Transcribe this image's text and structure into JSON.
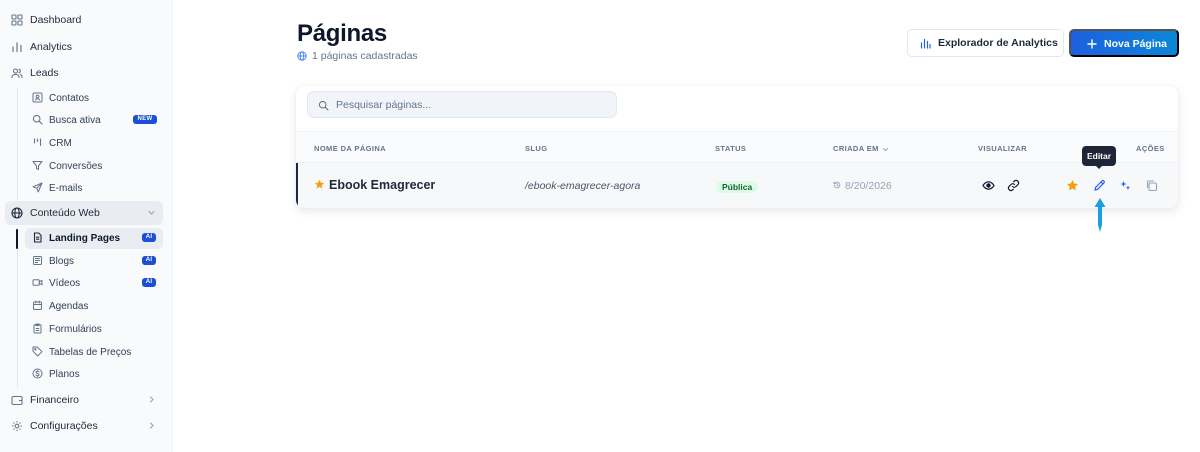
{
  "sidebar": {
    "dashboard": "Dashboard",
    "analytics": "Analytics",
    "leads": {
      "label": "Leads",
      "items": [
        "Contatos",
        "Busca ativa",
        "CRM",
        "Conversões",
        "E-mails"
      ],
      "new_badge": "NEW"
    },
    "content": {
      "label": "Conteúdo Web",
      "items": [
        "Landing Pages",
        "Blogs",
        "Vídeos",
        "Agendas",
        "Formulários",
        "Tabelas de Preços",
        "Planos"
      ],
      "ai_badge": "AI"
    },
    "financeiro": "Financeiro",
    "configuracoes": "Configurações"
  },
  "page": {
    "title": "Páginas",
    "subtitle": "1 páginas cadastradas"
  },
  "toolbar": {
    "analytics_label": "Explorador de Analytics",
    "new_label": "Nova Página"
  },
  "search": {
    "placeholder": "Pesquisar páginas..."
  },
  "table": {
    "headers": [
      "NOME DA PÁGINA",
      "SLUG",
      "STATUS",
      "CRIADA EM",
      "VISUALIZAR",
      "AÇÕES"
    ],
    "rows": [
      {
        "name": "Ebook Emagrecer",
        "slug": "/ebook-emagrecer-agora",
        "status": "Pública",
        "created": "8/20/2026",
        "favorite": true
      }
    ]
  },
  "tooltip": {
    "text": "Editar"
  },
  "colors": {
    "primary": "#1e5fe0",
    "accent": "#0b87d6",
    "star": "#f59e0b",
    "status_bg": "#dcfce7",
    "status_text": "#166534",
    "pointer": "#1a9fe0"
  }
}
